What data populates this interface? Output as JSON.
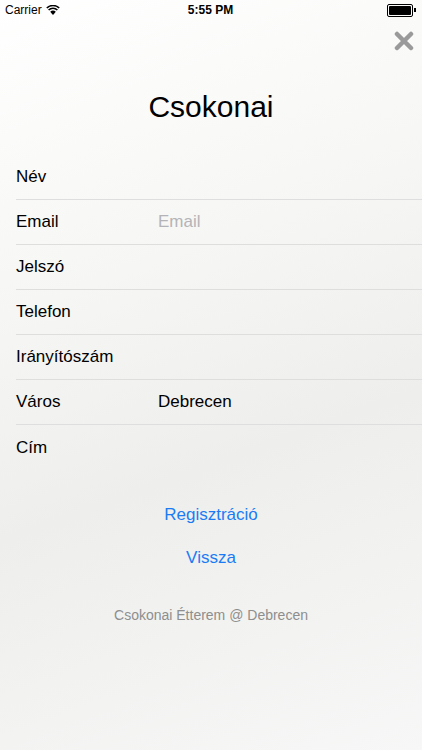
{
  "status_bar": {
    "carrier": "Carrier",
    "time": "5:55 PM",
    "battery_level": 1
  },
  "title": "Csokonai",
  "fields": [
    {
      "label": "Név",
      "value": "",
      "placeholder": ""
    },
    {
      "label": "Email",
      "value": "",
      "placeholder": "Email"
    },
    {
      "label": "Jelszó",
      "value": "",
      "placeholder": ""
    },
    {
      "label": "Telefon",
      "value": "",
      "placeholder": ""
    },
    {
      "label": "Irányítószám",
      "value": "",
      "placeholder": ""
    },
    {
      "label": "Város",
      "value": "Debrecen",
      "placeholder": ""
    },
    {
      "label": "Cím",
      "value": "",
      "placeholder": ""
    }
  ],
  "buttons": [
    "Regisztráció",
    "Vissza"
  ],
  "footer": "Csokonai Étterem @ Debrecen"
}
